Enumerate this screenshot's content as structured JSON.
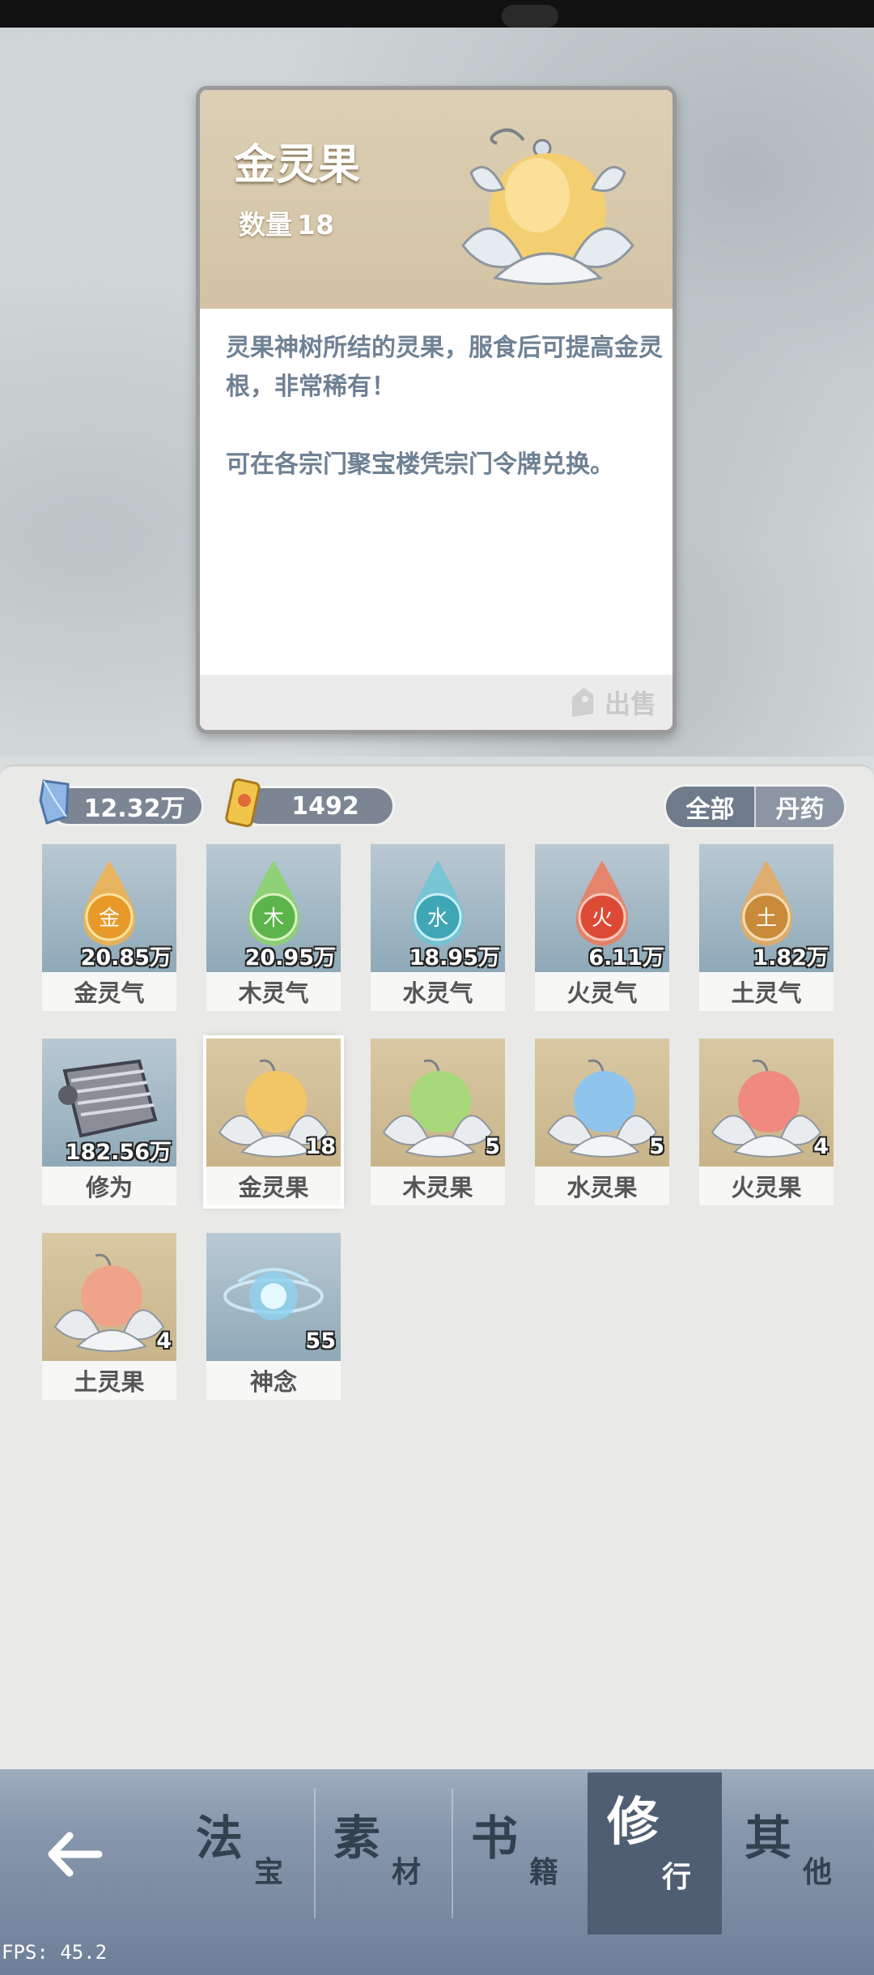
{
  "detail": {
    "name": "金灵果",
    "quantity_label": "数量",
    "quantity": "18",
    "description": [
      "灵果神树所结的灵果，服食后可提高金灵根，非常稀有！",
      "可在各宗门聚宝楼凭宗门令牌兑换。"
    ],
    "sell_label": "出售"
  },
  "resources": {
    "crystal": "12.32万",
    "token": "1492"
  },
  "filter_tabs": [
    "全部",
    "丹药"
  ],
  "items": [
    {
      "label": "金灵气",
      "count": "20.85万",
      "glyph": "金",
      "color": "#e9a93a",
      "bg": "blue"
    },
    {
      "label": "木灵气",
      "count": "20.95万",
      "glyph": "木",
      "color": "#6cc15a",
      "bg": "blue"
    },
    {
      "label": "水灵气",
      "count": "18.95万",
      "glyph": "水",
      "color": "#53b7c4",
      "bg": "blue"
    },
    {
      "label": "火灵气",
      "count": "6.11万",
      "glyph": "火",
      "color": "#e4604a",
      "bg": "blue"
    },
    {
      "label": "土灵气",
      "count": "1.82万",
      "glyph": "土",
      "color": "#d79a4a",
      "bg": "blue"
    },
    {
      "label": "修为",
      "count": "182.56万",
      "glyph": "",
      "color": "#777a86",
      "bg": "blue"
    },
    {
      "label": "金灵果",
      "count": "18",
      "glyph": "",
      "color": "#f1c96a",
      "bg": "gold"
    },
    {
      "label": "木灵果",
      "count": "5",
      "glyph": "",
      "color": "#a8dc7e",
      "bg": "gold"
    },
    {
      "label": "水灵果",
      "count": "5",
      "glyph": "",
      "color": "#8fc6ec",
      "bg": "gold"
    },
    {
      "label": "火灵果",
      "count": "4",
      "glyph": "",
      "color": "#f08a80",
      "bg": "gold"
    },
    {
      "label": "土灵果",
      "count": "4",
      "glyph": "",
      "color": "#efa48a",
      "bg": "gold"
    },
    {
      "label": "神念",
      "count": "55",
      "glyph": "",
      "color": "#bfe6f6",
      "bg": "blue"
    }
  ],
  "nav": [
    {
      "big": "法",
      "small": "宝"
    },
    {
      "big": "素",
      "small": "材"
    },
    {
      "big": "书",
      "small": "籍"
    },
    {
      "big": "修",
      "small": "行"
    },
    {
      "big": "其",
      "small": "他"
    }
  ],
  "fps": "FPS: 45.2"
}
